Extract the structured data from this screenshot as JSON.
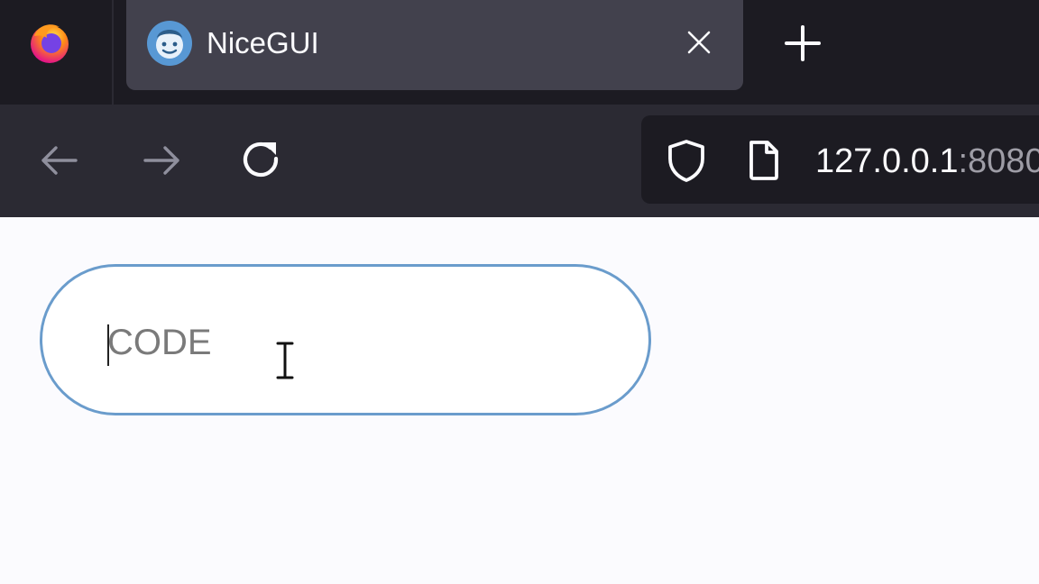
{
  "browser": {
    "tab": {
      "title": "NiceGUI"
    },
    "address_bar": {
      "host": "127.0.0.1",
      "port_partial": ":8080"
    },
    "icons": {
      "browser_logo": "firefox-logo",
      "tab_favicon": "nicegui-logo",
      "tab_close": "close-icon",
      "new_tab": "plus-icon",
      "back": "arrow-left-icon",
      "forward": "arrow-right-icon",
      "reload": "reload-icon",
      "tracking_protection": "shield-icon",
      "page_info": "page-icon"
    }
  },
  "page": {
    "code_input": {
      "placeholder": "CODE",
      "value": ""
    }
  },
  "colors": {
    "input_border": "#6a9ccc",
    "tab_active": "#42414d",
    "toolbar": "#2b2a33",
    "tabstrip": "#1c1b22"
  }
}
